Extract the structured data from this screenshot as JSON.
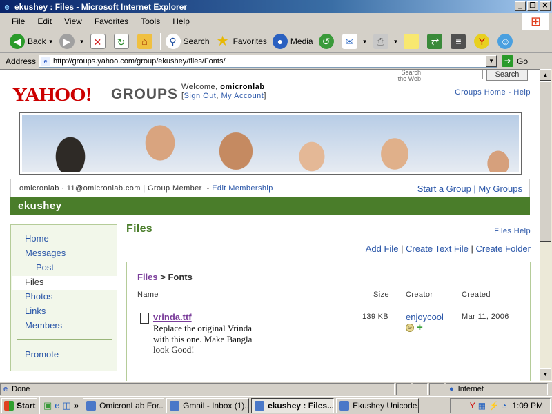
{
  "window": {
    "title": "ekushey : Files - Microsoft Internet Explorer"
  },
  "menu": [
    "File",
    "Edit",
    "View",
    "Favorites",
    "Tools",
    "Help"
  ],
  "toolbar": {
    "back": "Back",
    "search": "Search",
    "favorites": "Favorites",
    "media": "Media"
  },
  "address": {
    "label": "Address",
    "url": "http://groups.yahoo.com/group/ekushey/files/Fonts/",
    "go": "Go"
  },
  "header": {
    "search_web": "Search the Web",
    "search_button": "Search",
    "logo": "YAHOO!",
    "logo_groups": "GROUPS",
    "welcome": "Welcome,",
    "user": "omicronlab",
    "sign_out": "Sign Out",
    "my_account": "My Account",
    "groups_home": "Groups Home",
    "help": "Help"
  },
  "member_bar": {
    "info": "omicronlab · 11@omicronlab.com | Group Member",
    "edit": "Edit Membership",
    "start_group": "Start a Group",
    "my_groups": "My Groups"
  },
  "group_name": "ekushey",
  "sidenav": [
    "Home",
    "Messages",
    "Post",
    "Files",
    "Photos",
    "Links",
    "Members",
    "Promote"
  ],
  "files": {
    "title": "Files",
    "help": "Files Help",
    "add_file": "Add File",
    "create_text": "Create Text File",
    "create_folder": "Create Folder",
    "crumb_root": "Files",
    "crumb_current": "Fonts",
    "columns": {
      "name": "Name",
      "size": "Size",
      "creator": "Creator",
      "created": "Created"
    },
    "rows": [
      {
        "name": "vrinda.ttf",
        "desc": "Replace the original Vrinda with this one. Make Bangla look Good!",
        "size": "139 KB",
        "creator": "enjoycool",
        "created": "Mar 11, 2006"
      }
    ]
  },
  "status": {
    "text": "Done",
    "zone": "Internet"
  },
  "taskbar": {
    "start": "Start",
    "tasks": [
      "OmicronLab For...",
      "Gmail - Inbox (1)...",
      "ekushey : Files...",
      "Ekushey Unicode..."
    ],
    "clock": "1:09 PM"
  },
  "colors": {
    "brand_red": "#cc0000",
    "group_green": "#4a7d2a",
    "link_blue": "#2a56a8",
    "link_purple": "#7a3c9a"
  }
}
